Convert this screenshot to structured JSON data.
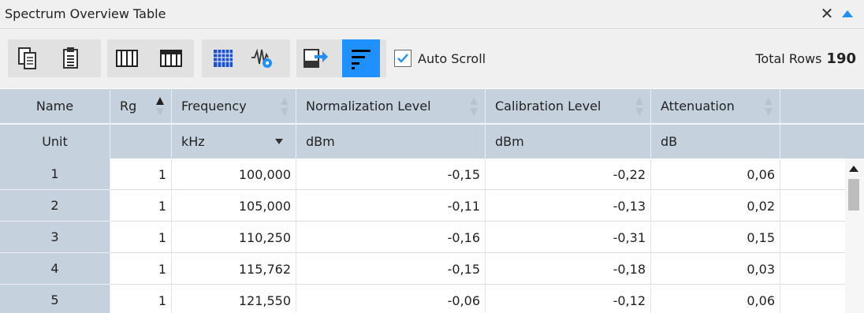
{
  "window": {
    "title": "Spectrum Overview Table",
    "close_glyph": "✕",
    "collapse_icon": "triangle-up-icon"
  },
  "toolbar": {
    "buttons": [
      {
        "name": "copy-button",
        "icon": "copy-icon"
      },
      {
        "name": "paste-button",
        "icon": "paste-icon"
      },
      {
        "name": "columns-button",
        "icon": "columns-icon"
      },
      {
        "name": "header-columns-button",
        "icon": "header-columns-icon"
      },
      {
        "name": "grid-button",
        "icon": "grid-icon"
      },
      {
        "name": "signal-settings-button",
        "icon": "signal-settings-icon"
      },
      {
        "name": "export-csv-button",
        "icon": "export-csv-icon"
      },
      {
        "name": "sort-lines-button",
        "icon": "sort-lines-icon",
        "active": true
      }
    ],
    "auto_scroll_label": "Auto Scroll",
    "auto_scroll_checked": true,
    "total_rows_label": "Total Rows",
    "total_rows_value": "190"
  },
  "colors": {
    "accent": "#1e90ff",
    "header_bg": "#c5d2de",
    "toolbar_bg": "#f0f0f0"
  },
  "table": {
    "header_name_row": [
      "Name",
      "Rg",
      "Frequency",
      "Normalization Level",
      "Calibration Level",
      "Attenuation"
    ],
    "header_unit_row": [
      "Unit",
      "",
      "kHz",
      "dBm",
      "dBm",
      "dB"
    ],
    "rows": [
      {
        "name": "1",
        "rg": "1",
        "frequency": "100,000",
        "normalization": "-0,15",
        "calibration": "-0,22",
        "attenuation": "0,06"
      },
      {
        "name": "2",
        "rg": "1",
        "frequency": "105,000",
        "normalization": "-0,11",
        "calibration": "-0,13",
        "attenuation": "0,02"
      },
      {
        "name": "3",
        "rg": "1",
        "frequency": "110,250",
        "normalization": "-0,16",
        "calibration": "-0,31",
        "attenuation": "0,15"
      },
      {
        "name": "4",
        "rg": "1",
        "frequency": "115,762",
        "normalization": "-0,15",
        "calibration": "-0,18",
        "attenuation": "0,03"
      },
      {
        "name": "5",
        "rg": "1",
        "frequency": "121,550",
        "normalization": "-0,06",
        "calibration": "-0,12",
        "attenuation": "0,06"
      }
    ]
  }
}
